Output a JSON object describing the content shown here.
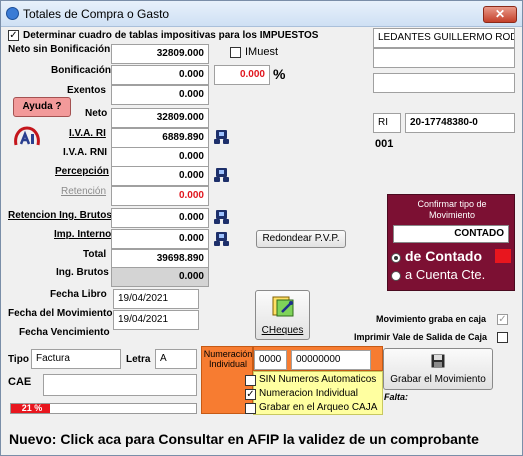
{
  "window": {
    "title": "Totales de Compra o Gasto",
    "close_glyph": "✕"
  },
  "header": {
    "determinar_label": "Determinar cuadro de tablas impositivas para los IMPUESTOS",
    "determinar_checked": "✓"
  },
  "form": {
    "neto_sin_bonif": {
      "label": "Neto sin Bonificación",
      "value": "32809.000"
    },
    "imuest": {
      "label": "IMuest",
      "value": "0.000",
      "pct": "%"
    },
    "bonificacion": {
      "label": "Bonificación",
      "value": "0.000"
    },
    "exentos": {
      "label": "Exentos",
      "value": "0.000"
    },
    "ayuda_label": "Ayuda ?",
    "neto": {
      "label": "Neto",
      "value": "32809.000"
    },
    "iva_ri": {
      "label": "I.V.A. RI",
      "value": "6889.890"
    },
    "iva_rni": {
      "label": "I.V.A. RNI",
      "value": "0.000"
    },
    "percepcion": {
      "label": "Percepción",
      "value": "0.000"
    },
    "retencion": {
      "label": "Retención",
      "value": "0.000"
    },
    "ret_ing_brutos": {
      "label": "Retencion Ing. Brutos",
      "value": "0.000"
    },
    "imp_interno": {
      "label": "Imp. Interno",
      "value": "0.000"
    },
    "total": {
      "label": "Total",
      "value": "39698.890"
    },
    "ing_brutos": {
      "label": "Ing. Brutos",
      "value": "0.000"
    },
    "redondear_label": "Redondear P.V.P.",
    "fecha_libro": {
      "label": "Fecha Libro",
      "value": "19/04/2021"
    },
    "fecha_movimiento": {
      "label": "Fecha del Movimiento",
      "value": "19/04/2021"
    },
    "fecha_vencimiento": {
      "label": "Fecha Vencimiento",
      "value": ""
    },
    "cheques_label": "CHeques"
  },
  "proveedor": {
    "nombre": "LEDANTES GUILLERMO RODC",
    "line2": "",
    "line3": "",
    "cond_iva": "RI",
    "cuit": "20-17748380-0",
    "codigo": "001"
  },
  "confirmar": {
    "caption": "Confirmar tipo de Movimiento",
    "value": "CONTADO",
    "opt_contado": "de Contado",
    "opt_cuenta": "a Cuenta Cte."
  },
  "caja": {
    "mov_graba": "Movimiento graba en caja",
    "imprimir_vale": "Imprimir Vale de Salida de Caja"
  },
  "comprobante": {
    "tipo_label": "Tipo",
    "tipo_value": "Factura",
    "letra_label": "Letra",
    "letra_value": "A",
    "numeracion_label": "Numeración Individual",
    "pv_value": "0000",
    "nro_value": "00000000",
    "sin_numeros": "SIN Numeros Automaticos",
    "numeracion_individual": "Numeracion Individual",
    "numeracion_checked": "✓",
    "grabar_arqueo": "Grabar en el Arqueo CAJA",
    "cae_label": "CAE",
    "cae_value": ""
  },
  "grabar": {
    "label": "Grabar el Movimiento",
    "falta_label": "Falta:"
  },
  "progress": {
    "percent": 21,
    "text": "21 %"
  },
  "footer": {
    "message": "Nuevo: Click aca para Consultar en AFIP la validez de un comprobante"
  },
  "colors": {
    "accent_red": "#e8161e",
    "panel_maroon": "#7c1033",
    "numeracion_orange": "#f77c31",
    "options_yellow": "#ffffa0"
  }
}
